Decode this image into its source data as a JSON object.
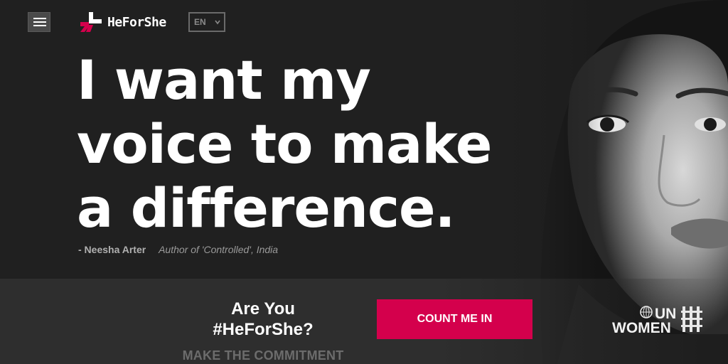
{
  "brand": {
    "name": "HeForShe",
    "accent": "#d4004c"
  },
  "nav": {
    "menu_icon": "hamburger-icon",
    "language": "EN"
  },
  "hero": {
    "quote_lines": [
      "I want my",
      "voice to make",
      "a difference."
    ],
    "author_name": "- Neesha Arter",
    "author_role": "Author of 'Controlled', India"
  },
  "cta": {
    "question_line1": "Are You",
    "question_line2": "#HeForShe?",
    "commit_label": "MAKE THE COMMITMENT",
    "button_label": "COUNT ME IN"
  },
  "partner": {
    "line1": "UN",
    "line2": "WOMEN"
  }
}
